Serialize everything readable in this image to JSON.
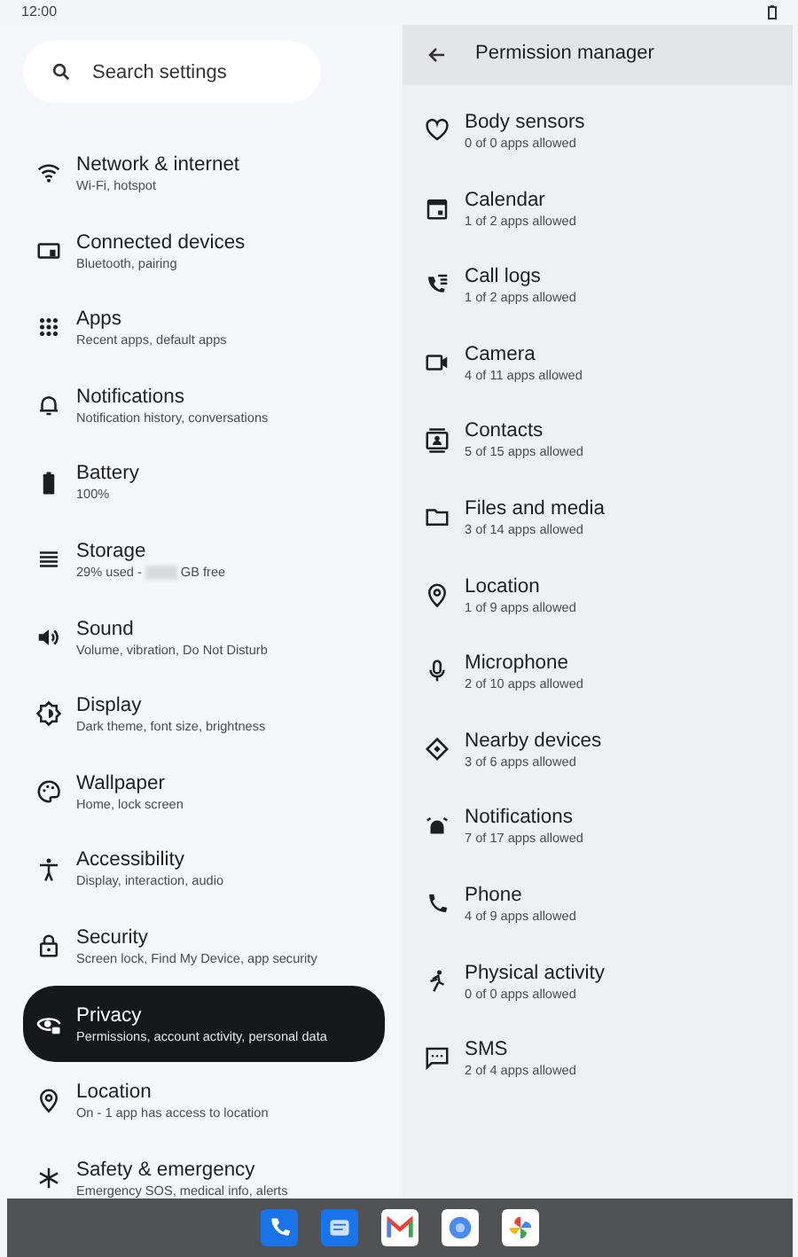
{
  "status_bar": {
    "time": "12:00"
  },
  "search": {
    "placeholder": "Search settings"
  },
  "settings": [
    {
      "title": "Network & internet",
      "subtitle": "Wi-Fi, hotspot",
      "selected": false
    },
    {
      "title": "Connected devices",
      "subtitle": "Bluetooth, pairing",
      "selected": false
    },
    {
      "title": "Apps",
      "subtitle": "Recent apps, default apps",
      "selected": false
    },
    {
      "title": "Notifications",
      "subtitle": "Notification history, conversations",
      "selected": false
    },
    {
      "title": "Battery",
      "subtitle": "100%",
      "selected": false
    },
    {
      "title": "Storage",
      "subtitle_parts": [
        "29% used -",
        "GB free"
      ],
      "selected": false
    },
    {
      "title": "Sound",
      "subtitle": "Volume, vibration, Do Not Disturb",
      "selected": false
    },
    {
      "title": "Display",
      "subtitle": "Dark theme, font size, brightness",
      "selected": false
    },
    {
      "title": "Wallpaper",
      "subtitle": "Home, lock screen",
      "selected": false
    },
    {
      "title": "Accessibility",
      "subtitle": "Display, interaction, audio",
      "selected": false
    },
    {
      "title": "Security",
      "subtitle": "Screen lock, Find My Device, app security",
      "selected": false
    },
    {
      "title": "Privacy",
      "subtitle": "Permissions, account activity, personal data",
      "selected": true
    },
    {
      "title": "Location",
      "subtitle": "On - 1 app has access to location",
      "selected": false
    },
    {
      "title": "Safety & emergency",
      "subtitle": "Emergency SOS, medical info, alerts",
      "selected": false
    }
  ],
  "permission_manager": {
    "title": "Permission manager",
    "permissions": [
      {
        "title": "Body sensors",
        "subtitle": "0 of 0 apps allowed"
      },
      {
        "title": "Calendar",
        "subtitle": "1 of 2 apps allowed"
      },
      {
        "title": "Call logs",
        "subtitle": "1 of 2 apps allowed"
      },
      {
        "title": "Camera",
        "subtitle": "4 of 11 apps allowed"
      },
      {
        "title": "Contacts",
        "subtitle": "5 of 15 apps allowed"
      },
      {
        "title": "Files and media",
        "subtitle": "3 of 14 apps allowed"
      },
      {
        "title": "Location",
        "subtitle": "1 of 9 apps allowed"
      },
      {
        "title": "Microphone",
        "subtitle": "2 of 10 apps allowed"
      },
      {
        "title": "Nearby devices",
        "subtitle": "3 of 6 apps allowed"
      },
      {
        "title": "Notifications",
        "subtitle": "7 of 17 apps allowed"
      },
      {
        "title": "Phone",
        "subtitle": "4 of 9 apps allowed"
      },
      {
        "title": "Physical activity",
        "subtitle": "0 of 0 apps allowed"
      },
      {
        "title": "SMS",
        "subtitle": "2 of 4 apps allowed"
      }
    ]
  }
}
